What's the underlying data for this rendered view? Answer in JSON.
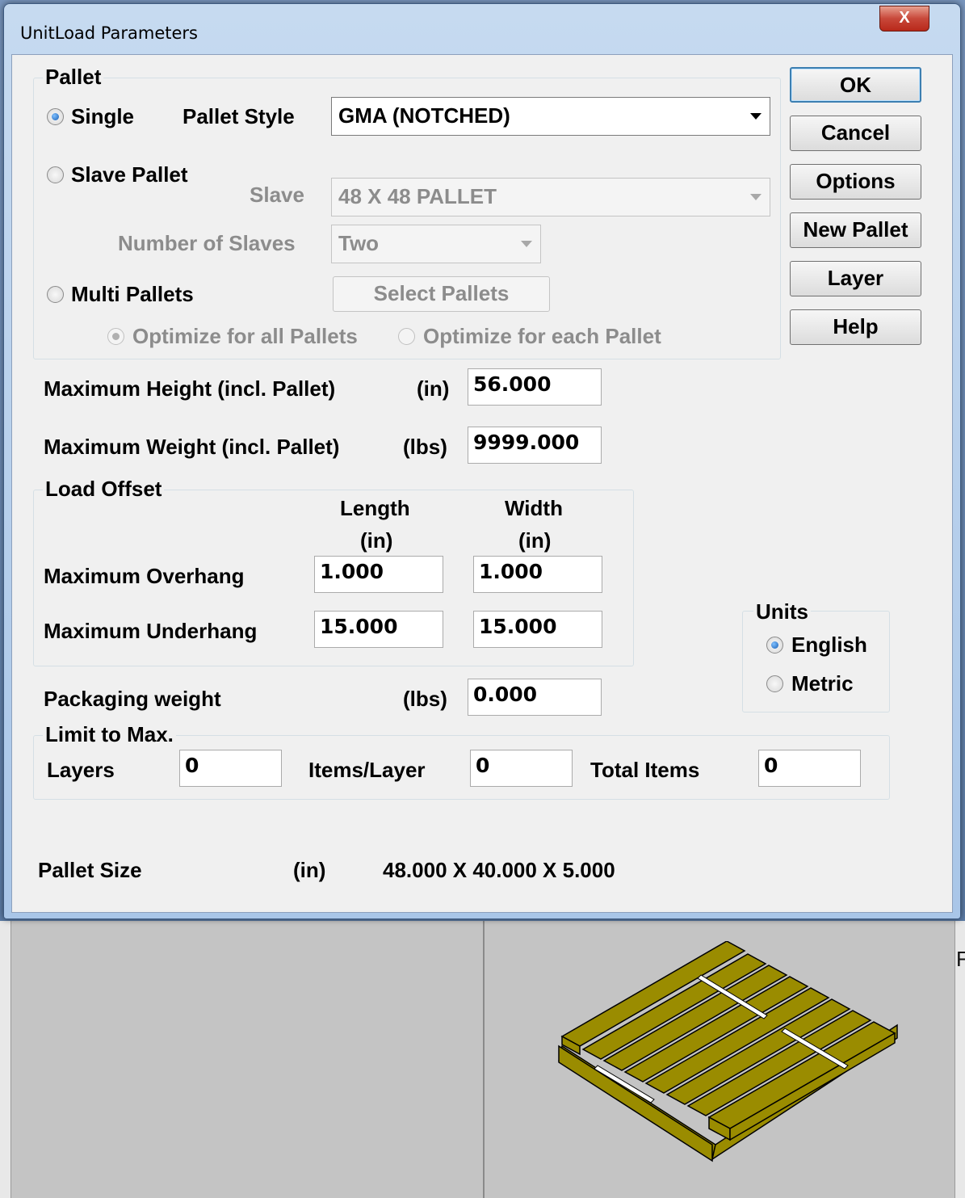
{
  "window": {
    "title": "UnitLoad Parameters",
    "close_label": "X"
  },
  "pallet_group": {
    "title": "Pallet",
    "single": {
      "label": "Single",
      "selected": true
    },
    "pallet_style": {
      "label": "Pallet Style",
      "value": "GMA (NOTCHED)"
    },
    "slave_pallet": {
      "label": "Slave Pallet",
      "selected": false
    },
    "slave": {
      "label": "Slave",
      "value": "48 X 48 PALLET"
    },
    "number_of_slaves": {
      "label": "Number of Slaves",
      "value": "Two"
    },
    "multi_pallets": {
      "label": "Multi Pallets",
      "selected": false
    },
    "select_pallets_label": "Select Pallets",
    "optimize_all": {
      "label": "Optimize for all Pallets",
      "selected": true
    },
    "optimize_each": {
      "label": "Optimize for each Pallet",
      "selected": false
    }
  },
  "buttons": {
    "ok": "OK",
    "cancel": "Cancel",
    "options": "Options",
    "new_pallet": "New Pallet",
    "layer": "Layer",
    "help": "Help"
  },
  "max_height": {
    "label": "Maximum Height (incl. Pallet)",
    "unit": "(in)",
    "value": "56.000"
  },
  "max_weight": {
    "label": "Maximum Weight (incl. Pallet)",
    "unit": "(lbs)",
    "value": "9999.000"
  },
  "load_offset": {
    "title": "Load Offset",
    "length_header": "Length",
    "length_unit": "(in)",
    "width_header": "Width",
    "width_unit": "(in)",
    "overhang": {
      "label": "Maximum Overhang",
      "length": "1.000",
      "width": "1.000"
    },
    "underhang": {
      "label": "Maximum Underhang",
      "length": "15.000",
      "width": "15.000"
    }
  },
  "units": {
    "title": "Units",
    "english": {
      "label": "English",
      "selected": true
    },
    "metric": {
      "label": "Metric",
      "selected": false
    }
  },
  "packaging_weight": {
    "label": "Packaging weight",
    "unit": "(lbs)",
    "value": "0.000"
  },
  "limit": {
    "title": "Limit to Max.",
    "layers": {
      "label": "Layers",
      "value": "0"
    },
    "items_per_layer": {
      "label": "Items/Layer",
      "value": "0"
    },
    "total_items": {
      "label": "Total Items",
      "value": "0"
    }
  },
  "pallet_size": {
    "label": "Pallet Size",
    "unit": "(in)",
    "value": "48.000 X 40.000 X 5.000"
  },
  "background": {
    "edge_label": "F"
  },
  "colors": {
    "pallet_fill": "#9a8c00",
    "pallet_stroke": "#000000",
    "accent": "#3c7fb1"
  }
}
